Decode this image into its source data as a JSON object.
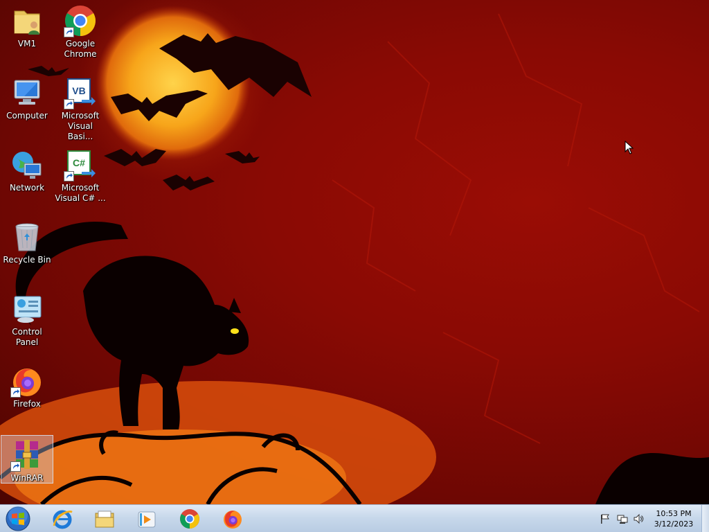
{
  "desktop": {
    "icons": [
      {
        "label": "VM1",
        "icon": "user-folder-icon",
        "shortcut": false
      },
      {
        "label": "Google\nChrome",
        "icon": "chrome-icon",
        "shortcut": true
      },
      {
        "label": "Computer",
        "icon": "computer-icon",
        "shortcut": false
      },
      {
        "label": "Microsoft\nVisual Basi...",
        "icon": "visual-basic-icon",
        "shortcut": true
      },
      {
        "label": "Network",
        "icon": "network-icon",
        "shortcut": false
      },
      {
        "label": "Microsoft\nVisual C# ...",
        "icon": "visual-csharp-icon",
        "shortcut": true
      },
      {
        "label": "Recycle Bin",
        "icon": "recycle-bin-icon",
        "shortcut": false
      },
      {
        "label": "Control Panel",
        "icon": "control-panel-icon",
        "shortcut": false
      },
      {
        "label": "Firefox",
        "icon": "firefox-icon",
        "shortcut": true
      },
      {
        "label": "WinRAR",
        "icon": "winrar-icon",
        "shortcut": true,
        "selected": true
      }
    ]
  },
  "taskbar": {
    "pinned": [
      {
        "name": "internet-explorer",
        "icon": "internet-explorer-icon"
      },
      {
        "name": "windows-explorer",
        "icon": "file-explorer-icon"
      },
      {
        "name": "media-player",
        "icon": "media-player-icon"
      },
      {
        "name": "google-chrome",
        "icon": "chrome-icon"
      },
      {
        "name": "firefox",
        "icon": "firefox-icon"
      }
    ],
    "tray": [
      "action-center-flag-icon",
      "network-icon",
      "volume-icon"
    ],
    "clock": {
      "time": "10:53 PM",
      "date": "3/12/2023"
    }
  },
  "colors": {
    "wallpaper_red": "#8a0a04",
    "moon_orange": "#f2a21a",
    "taskbar": "#c6d7ea"
  }
}
